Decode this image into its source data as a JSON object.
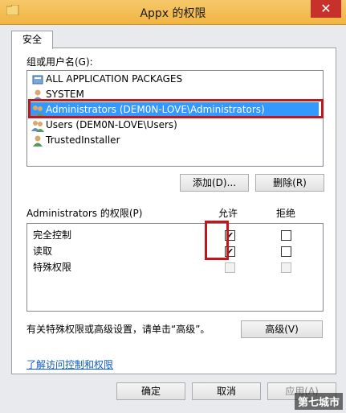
{
  "window": {
    "title": "Appx 的权限",
    "close_glyph": "✕"
  },
  "tabs": [
    {
      "label": "安全"
    }
  ],
  "groups": {
    "label": "组或用户名(G):",
    "items": [
      {
        "label": "ALL APPLICATION PACKAGES",
        "icon": "package-icon",
        "selected": false
      },
      {
        "label": "SYSTEM",
        "icon": "user-icon",
        "selected": false
      },
      {
        "label": "Administrators (DEM0N-LOVE\\Administrators)",
        "icon": "users-icon",
        "selected": true
      },
      {
        "label": "Users (DEM0N-LOVE\\Users)",
        "icon": "users-icon",
        "selected": false
      },
      {
        "label": "TrustedInstaller",
        "icon": "user-icon",
        "selected": false
      }
    ]
  },
  "buttons": {
    "add": "添加(D)...",
    "remove": "删除(R)",
    "advanced": "高级(V)",
    "ok": "确定",
    "cancel": "取消",
    "apply": "应用(A)"
  },
  "permissions": {
    "label": "Administrators 的权限(P)",
    "allow_header": "允许",
    "deny_header": "拒绝",
    "rows": [
      {
        "name": "完全控制",
        "allow": true,
        "deny": false,
        "disabled": false
      },
      {
        "name": "读取",
        "allow": true,
        "deny": false,
        "disabled": false
      },
      {
        "name": "特殊权限",
        "allow": false,
        "deny": false,
        "disabled": true
      }
    ]
  },
  "advanced_hint": "有关特殊权限或高级设置，请单击“高级”。",
  "link": "了解访问控制和权限",
  "watermark": "第七城市",
  "colors": {
    "titlebar": "#f1b440",
    "selection": "#3399ff",
    "highlight": "#c0161c",
    "link": "#0a5bc4"
  }
}
